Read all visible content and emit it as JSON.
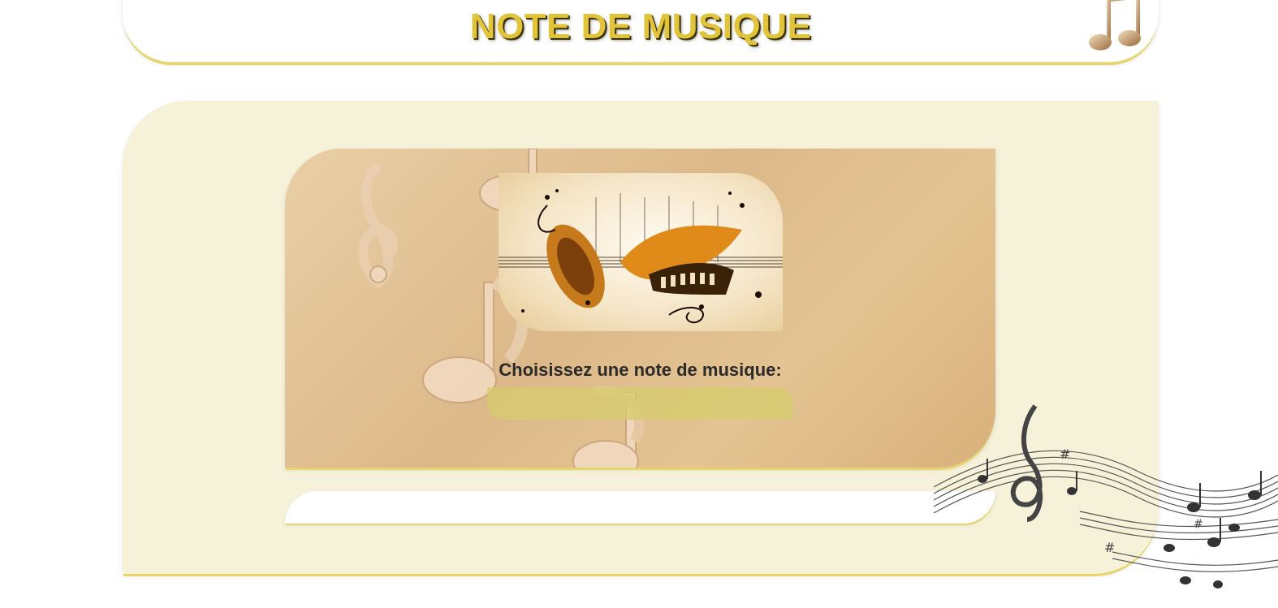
{
  "header": {
    "title": "NOTE DE MUSIQUE"
  },
  "form": {
    "prompt": "Choisissez une note de musique:",
    "selected_value": ""
  },
  "result": {
    "text": ""
  },
  "colors": {
    "accent_gold": "#e2c43a",
    "panel_cream": "#f6f2da",
    "select_fill": "#d6cc6e",
    "border_gold": "#e6d46a"
  },
  "icons": {
    "header": "eighth-notes-icon",
    "hero": "music-instruments-illustration",
    "decoration": "musical-staff-decoration"
  }
}
